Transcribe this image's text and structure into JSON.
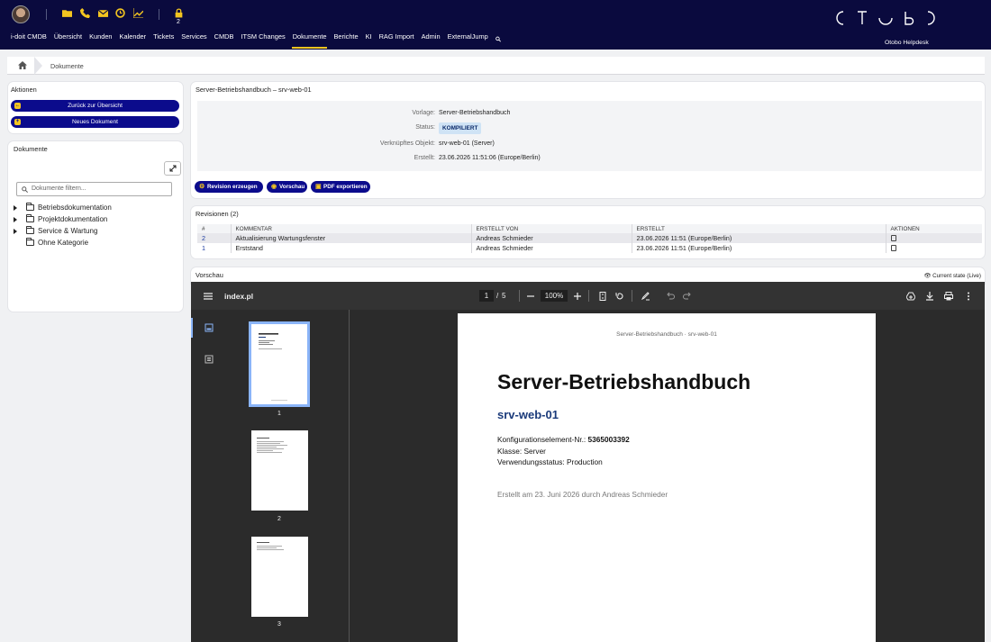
{
  "header": {
    "lock_count": "2",
    "nav": [
      "i-doit CMDB",
      "Übersicht",
      "Kunden",
      "Kalender",
      "Tickets",
      "Services",
      "CMDB",
      "ITSM Changes",
      "Dokumente",
      "Berichte",
      "KI",
      "RAG Import",
      "Admin",
      "ExternalJump"
    ],
    "active_nav": "Dokumente",
    "brand_subtitle": "Otobo Helpdesk"
  },
  "breadcrumb": {
    "current": "Dokumente"
  },
  "actions": {
    "title": "Aktionen",
    "back_label": "Zurück zur Übersicht",
    "new_label": "Neues Dokument"
  },
  "documents": {
    "title": "Dokumente",
    "filter_placeholder": "Dokumente filtern...",
    "tree": [
      "Betriebsdokumentation",
      "Projektdokumentation",
      "Service & Wartung",
      "Ohne Kategorie"
    ]
  },
  "detail": {
    "title": "Server-Betriebshandbuch – srv-web-01",
    "template_label": "Vorlage:",
    "template_value": "Server-Betriebshandbuch",
    "status_label": "Status:",
    "status_value": "KOMPILIERT",
    "object_label": "Verknüpftes Objekt:",
    "object_value": "srv-web-01 (Server)",
    "created_label": "Erstellt:",
    "created_value": "23.06.2026 11:51:06 (Europe/Berlin)",
    "btn_revision": "Revision erzeugen",
    "btn_preview": "Vorschau",
    "btn_pdf": "PDF exportieren"
  },
  "revisions": {
    "title": "Revisionen (2)",
    "columns": [
      "#",
      "KOMMENTAR",
      "ERSTELLT VON",
      "ERSTELLT",
      "AKTIONEN"
    ],
    "rows": [
      {
        "num": "2",
        "comment": "Aktualisierung Wartungsfenster",
        "by": "Andreas Schmieder",
        "created": "23.06.2026 11:51 (Europe/Berlin)"
      },
      {
        "num": "1",
        "comment": "Erststand",
        "by": "Andreas Schmieder",
        "created": "23.06.2026 11:51 (Europe/Berlin)"
      }
    ]
  },
  "preview": {
    "title": "Vorschau",
    "state": "Current state (Live)",
    "filename": "index.pl",
    "page_current": "1",
    "page_sep": "/",
    "page_total": "5",
    "zoom": "100%",
    "thumb_labels": [
      "1",
      "2",
      "3"
    ]
  },
  "pdf_page": {
    "running_header": "Server-Betriebshandbuch · srv-web-01",
    "heading": "Server-Betriebshandbuch",
    "subheading": "srv-web-01",
    "ci_label": "Konfigurationselement-Nr.: ",
    "ci_value": "5365003392",
    "class_line": "Klasse: Server",
    "usage_line": "Verwendungsstatus: Production",
    "created_line": "Erstellt am 23. Juni 2026 durch Andreas Schmieder"
  },
  "colors": {
    "nav_bg": "#0a0a3e",
    "accent": "#f3c520",
    "button": "#0b0b8c"
  }
}
